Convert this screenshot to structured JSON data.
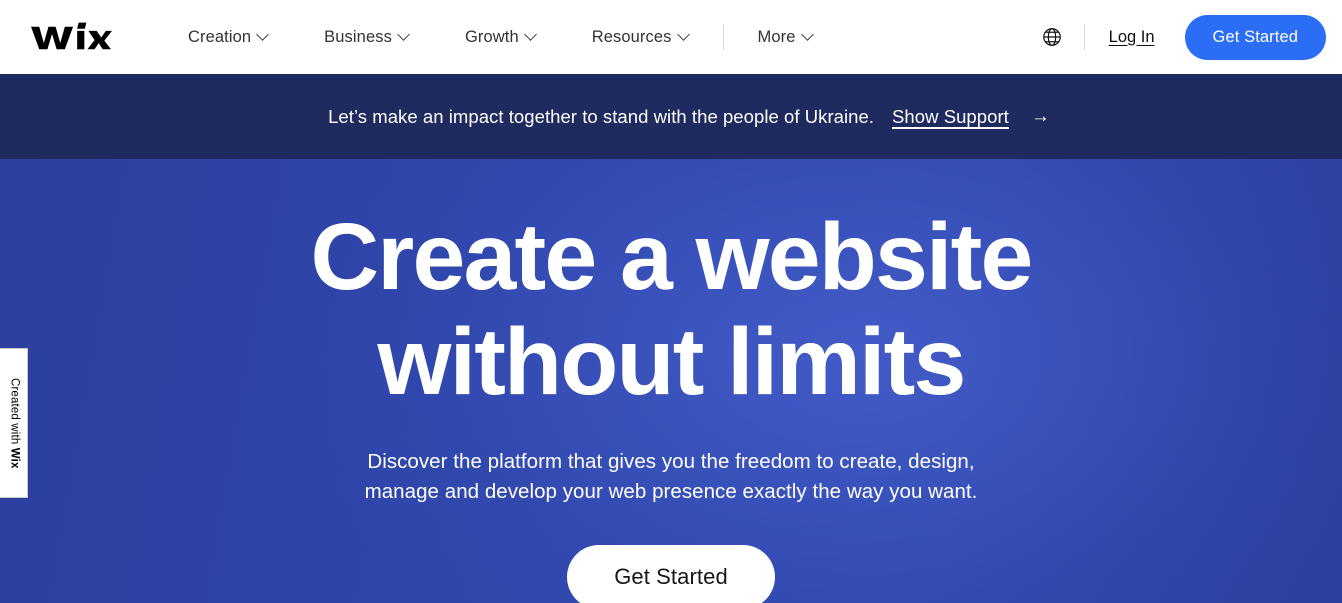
{
  "header": {
    "logo_alt": "Wix",
    "nav": [
      {
        "label": "Creation",
        "has_chevron": true
      },
      {
        "label": "Business",
        "has_chevron": true
      },
      {
        "label": "Growth",
        "has_chevron": true
      },
      {
        "label": "Resources",
        "has_chevron": true
      },
      {
        "label": "More",
        "has_chevron": true
      }
    ],
    "language_icon": "globe-icon",
    "login_label": "Log In",
    "cta_label": "Get Started",
    "cta_color": "#2b6ef5"
  },
  "banner": {
    "flag_icon": "ukraine-flag-icon",
    "text": "Let’s make an impact together to stand with the people of Ukraine.",
    "link_label": "Show Support",
    "arrow": "→",
    "background_color": "#1f2a5e"
  },
  "hero": {
    "title_line1": "Create a website",
    "title_line2": "without limits",
    "subtitle_line1": "Discover the platform that gives you the freedom to create, design,",
    "subtitle_line2": "manage and develop your web presence exactly the way you want.",
    "cta_label": "Get Started",
    "background_color": "#3048ad"
  },
  "badge": {
    "prefix": "Created with ",
    "brand": "Wix"
  }
}
